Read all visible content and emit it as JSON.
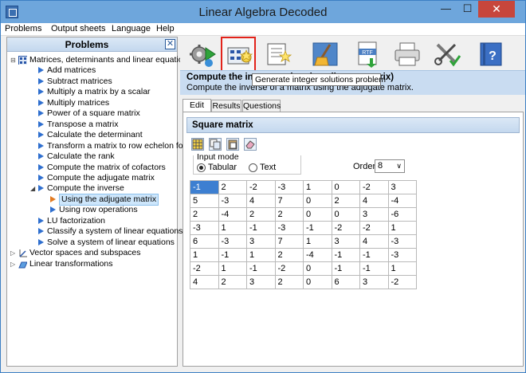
{
  "window": {
    "title": "Linear Algebra Decoded",
    "min": "—",
    "max": "☐",
    "close": "✕"
  },
  "menu": [
    "Problems",
    "Output sheets",
    "Language",
    "Help"
  ],
  "left_panel": {
    "title": "Problems",
    "close": "✕"
  },
  "tree": [
    {
      "label": "Matrices, determinants and linear equations",
      "level": 0,
      "expander": "⊟",
      "kind": "folder"
    },
    {
      "label": "Add matrices",
      "level": 1
    },
    {
      "label": "Subtract matrices",
      "level": 1
    },
    {
      "label": "Multiply a matrix by a scalar",
      "level": 1
    },
    {
      "label": "Multiply matrices",
      "level": 1
    },
    {
      "label": "Power of a square matrix",
      "level": 1
    },
    {
      "label": "Transpose a matrix",
      "level": 1
    },
    {
      "label": "Calculate the determinant",
      "level": 1
    },
    {
      "label": "Transform a matrix to row echelon form",
      "level": 1
    },
    {
      "label": "Calculate the rank",
      "level": 1
    },
    {
      "label": "Compute the matrix of cofactors",
      "level": 1
    },
    {
      "label": "Compute the adjugate matrix",
      "level": 1
    },
    {
      "label": "Compute the inverse",
      "level": 1,
      "expander": "◢"
    },
    {
      "label": "Using the adjugate matrix",
      "level": 2,
      "selected": true
    },
    {
      "label": "Using row operations",
      "level": 2
    },
    {
      "label": "LU factorization",
      "level": 1
    },
    {
      "label": "Classify a system of linear equations",
      "level": 1
    },
    {
      "label": "Solve a system of linear equations",
      "level": 1
    },
    {
      "label": "Vector spaces and subspaces",
      "level": 0,
      "expander": "▷",
      "kind": "vector"
    },
    {
      "label": "Linear transformations",
      "level": 0,
      "expander": "▷",
      "kind": "transform"
    }
  ],
  "toolbar": {
    "buttons": [
      {
        "name": "run-gear-icon"
      },
      {
        "name": "generate-integer-icon",
        "active": true
      },
      {
        "name": "edit-sheet-icon"
      },
      {
        "name": "clean-broom-icon"
      },
      {
        "name": "export-rtf-icon",
        "label": "RTF"
      },
      {
        "name": "printer-icon"
      },
      {
        "name": "settings-tools-icon"
      },
      {
        "name": "help-book-icon",
        "label": "?"
      }
    ],
    "tooltip": "Generate integer solutions problem"
  },
  "header": {
    "title": "Compute the inverse using the adjugate matrix)",
    "desc": "Compute the inverse of a matrix using the adjugate matrix."
  },
  "tabs": [
    "Edit",
    "Results",
    "Questions"
  ],
  "section_title": "Square matrix",
  "input_mode": {
    "legend": "Input mode",
    "options": [
      "Tabular",
      "Text"
    ],
    "selected": "Tabular"
  },
  "order": {
    "label": "Order",
    "value": "8",
    "chevron": "∨"
  },
  "matrix": [
    [
      "-1",
      "2",
      "-2",
      "-3",
      "1",
      "0",
      "-2",
      "3"
    ],
    [
      "5",
      "-3",
      "4",
      "7",
      "0",
      "2",
      "4",
      "-4"
    ],
    [
      "2",
      "-4",
      "2",
      "2",
      "0",
      "0",
      "3",
      "-6"
    ],
    [
      "-3",
      "1",
      "-1",
      "-3",
      "-1",
      "-2",
      "-2",
      "1"
    ],
    [
      "6",
      "-3",
      "3",
      "7",
      "1",
      "3",
      "4",
      "-3"
    ],
    [
      "1",
      "-1",
      "1",
      "2",
      "-4",
      "-1",
      "-1",
      "-3"
    ],
    [
      "-2",
      "1",
      "-1",
      "-2",
      "0",
      "-1",
      "-1",
      "1"
    ],
    [
      "4",
      "2",
      "3",
      "2",
      "0",
      "6",
      "3",
      "-2"
    ]
  ]
}
